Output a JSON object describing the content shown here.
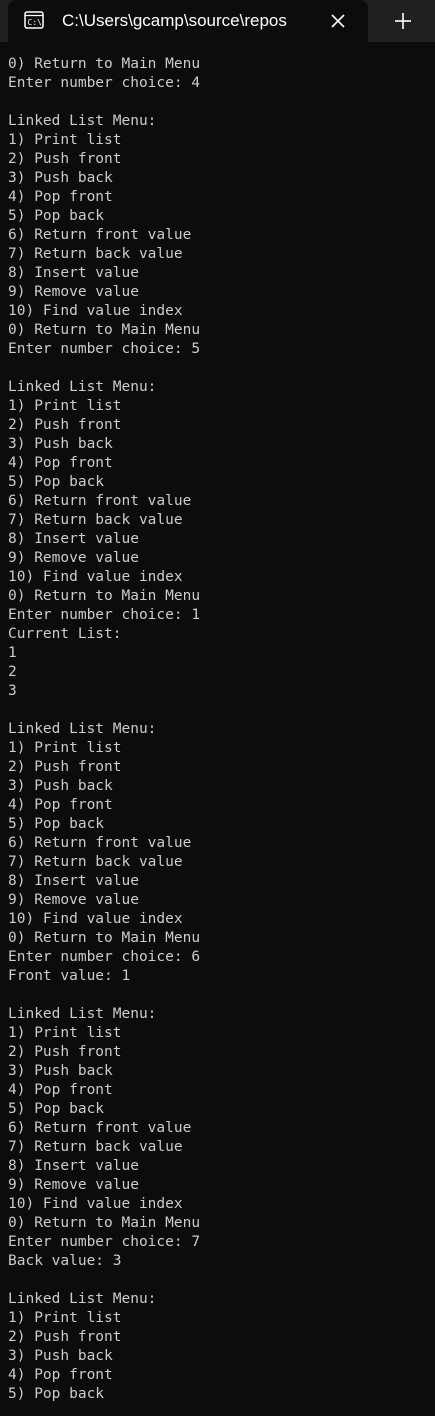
{
  "window": {
    "tab_title": "C:\\Users\\gcamp\\source\\repos",
    "tab_icon": "terminal-icon",
    "close_icon": "close-icon",
    "new_tab_icon": "plus-icon"
  },
  "terminal": {
    "lines": [
      "0) Return to Main Menu",
      "Enter number choice: 4",
      "",
      "Linked List Menu:",
      "1) Print list",
      "2) Push front",
      "3) Push back",
      "4) Pop front",
      "5) Pop back",
      "6) Return front value",
      "7) Return back value",
      "8) Insert value",
      "9) Remove value",
      "10) Find value index",
      "0) Return to Main Menu",
      "Enter number choice: 5",
      "",
      "Linked List Menu:",
      "1) Print list",
      "2) Push front",
      "3) Push back",
      "4) Pop front",
      "5) Pop back",
      "6) Return front value",
      "7) Return back value",
      "8) Insert value",
      "9) Remove value",
      "10) Find value index",
      "0) Return to Main Menu",
      "Enter number choice: 1",
      "Current List:",
      "1",
      "2",
      "3",
      "",
      "Linked List Menu:",
      "1) Print list",
      "2) Push front",
      "3) Push back",
      "4) Pop front",
      "5) Pop back",
      "6) Return front value",
      "7) Return back value",
      "8) Insert value",
      "9) Remove value",
      "10) Find value index",
      "0) Return to Main Menu",
      "Enter number choice: 6",
      "Front value: 1",
      "",
      "Linked List Menu:",
      "1) Print list",
      "2) Push front",
      "3) Push back",
      "4) Pop front",
      "5) Pop back",
      "6) Return front value",
      "7) Return back value",
      "8) Insert value",
      "9) Remove value",
      "10) Find value index",
      "0) Return to Main Menu",
      "Enter number choice: 7",
      "Back value: 3",
      "",
      "Linked List Menu:",
      "1) Print list",
      "2) Push front",
      "3) Push back",
      "4) Pop front",
      "5) Pop back"
    ]
  }
}
